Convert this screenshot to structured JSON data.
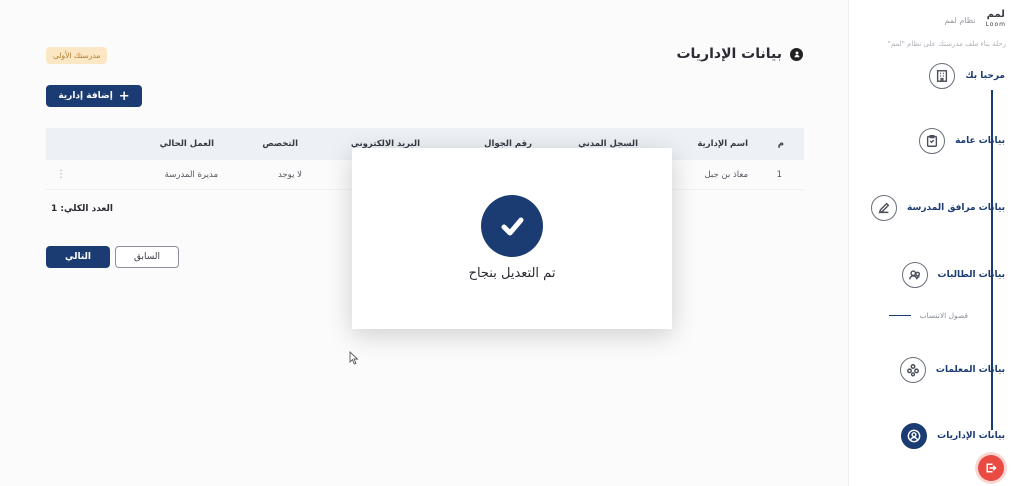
{
  "brand": {
    "name": "نظام لمم",
    "logo": "لمم",
    "logo_sub": "Loom",
    "tagline": "رحلة بناء ملف مدرستك على نظام \"لمم\""
  },
  "steps": [
    {
      "label": "مرحبا بك",
      "icon": "building-icon"
    },
    {
      "label": "بيانات عامة",
      "icon": "clipboard-icon"
    },
    {
      "label": "بيانات مرافق المدرسة",
      "icon": "pencil-icon"
    },
    {
      "label": "بيانات الطالبات",
      "icon": "users-icon"
    },
    {
      "label": "بيانات المعلمات",
      "icon": "group-icon"
    },
    {
      "label": "بيانات الإداريات",
      "icon": "person-icon"
    }
  ],
  "substep": {
    "label": "فصول الانتساب"
  },
  "page": {
    "title": "بيانات الإداريات",
    "school_badge": "مدرستك الأولى",
    "add_button": "إضافة إدارية"
  },
  "table": {
    "columns": [
      "م",
      "اسم الإدارية",
      "السجل المدني",
      "رقم الجوال",
      "البريد الالكتروني",
      "التخصص",
      "العمل الحالي"
    ],
    "rows": [
      [
        "1",
        "معاذ بن جبل",
        "",
        "",
        "",
        "لا يوجد",
        "مديرة المدرسة"
      ]
    ]
  },
  "total_label": "العدد الكلي: 1",
  "buttons": {
    "next": "التالي",
    "previous": "السابق"
  },
  "modal": {
    "message": "تم التعديل بنجاح"
  },
  "colors": {
    "primary": "#1b3c72",
    "danger": "#e94a42",
    "badge_bg": "#fbe7c4",
    "header_bg": "#edf0f5"
  }
}
